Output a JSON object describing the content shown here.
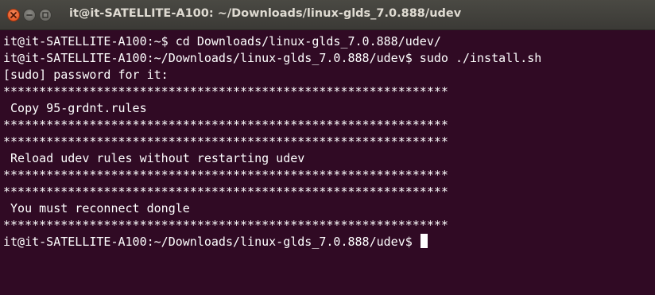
{
  "window": {
    "title": "it@it-SATELLITE-A100: ~/Downloads/linux-glds_7.0.888/udev",
    "controls": [
      "close-icon",
      "minimize-icon",
      "maximize-icon"
    ]
  },
  "colors": {
    "terminal_background": "#300a24",
    "terminal_text": "#ffffff",
    "close_button": "#df4a16",
    "titlebar": "#3c3b37"
  },
  "terminal": {
    "lines": [
      "it@it-SATELLITE-A100:~$ cd Downloads/linux-glds_7.0.888/udev/",
      "it@it-SATELLITE-A100:~/Downloads/linux-glds_7.0.888/udev$ sudo ./install.sh",
      "[sudo] password for it:",
      "**************************************************************",
      " Copy 95-grdnt.rules",
      "**************************************************************",
      "**************************************************************",
      " Reload udev rules without restarting udev",
      "**************************************************************",
      "**************************************************************",
      " You must reconnect dongle",
      "**************************************************************"
    ],
    "prompt": "it@it-SATELLITE-A100:~/Downloads/linux-glds_7.0.888/udev$ "
  }
}
